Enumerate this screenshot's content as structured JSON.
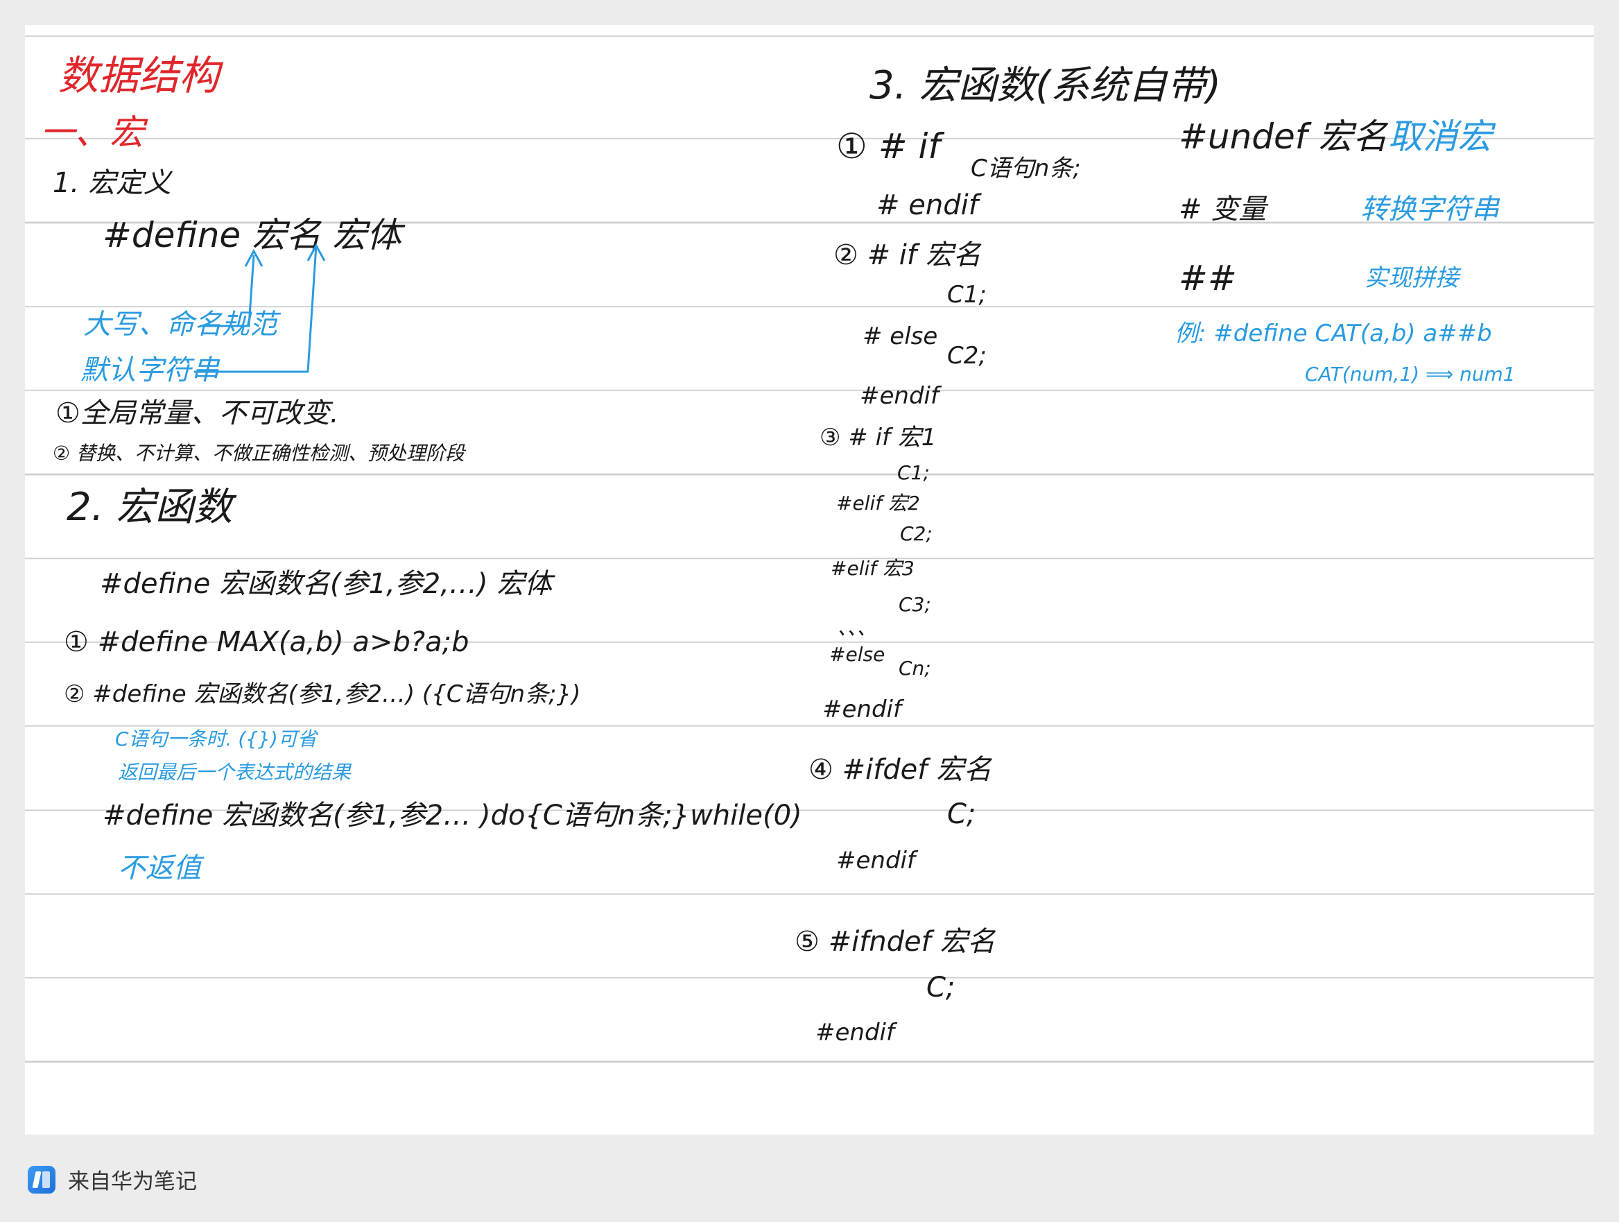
{
  "left": {
    "title": "数据结构",
    "section1": "一、宏",
    "s1_1": "1. 宏定义",
    "s1_1_syntax": "#define  宏名  宏体",
    "note_upper": "大写、命名规范",
    "note_string": "默认字符串",
    "point1": "①全局常量、不可改变.",
    "point2": "② 替换、不计算、不做正确性检测、预处理阶段",
    "s2": "2. 宏函数",
    "s2_syntax": "#define  宏函数名(参1,参2,…)    宏体",
    "ex1": "① #define  MAX(a,b)   a>b?a;b",
    "ex2": "② #define  宏函数名(参1,参2…)  ({C语句n条;})",
    "note_single": "C语句一条时. ({})可省",
    "note_return": "返回最后一个表达式的结果",
    "do_while": "#define  宏函数名(参1,参2…     )do{C语句n条;}while(0)",
    "note_noreturn": "不返值"
  },
  "middle": {
    "s3": "3. 宏函数(系统自带)",
    "c1_if": "① # if",
    "c1_stmt": "C语句n条;",
    "c1_endif": "# endif",
    "c2_if": "② # if  宏名",
    "c2_c1": "C1;",
    "c2_else": "# else",
    "c2_c2": "C2;",
    "c2_endif": "#endif",
    "c3_if": "③ # if  宏1",
    "c3_c1": "C1;",
    "c3_elif1": "#elif  宏2",
    "c3_c2": "C2;",
    "c3_elif2": "#elif  宏3",
    "c3_c3": "C3;",
    "c3_dots": "、、、",
    "c3_else": "#else",
    "c3_cn": "Cn;",
    "c3_endif": "#endif",
    "c4_ifdef": "④ #ifdef  宏名",
    "c4_c": "C;",
    "c4_endif": "#endif",
    "c5_ifndef": "⑤ #ifndef 宏名",
    "c5_c": "C;",
    "c5_endif": "#endif"
  },
  "right": {
    "undef": "#undef  宏名",
    "undef_note": "取消宏",
    "hash": "# 变量",
    "hash_note": "转换字符串",
    "hashhash": "##",
    "hashhash_note": "实现拼接",
    "example": "例:  #define  CAT(a,b)   a##b",
    "example2": "CAT(num,1)  ⟹  num1"
  },
  "footer": {
    "app": "来自华为笔记"
  },
  "colors": {
    "ink": "#1a1a1a",
    "red": "#e0262b",
    "blue": "#2a9be0"
  }
}
